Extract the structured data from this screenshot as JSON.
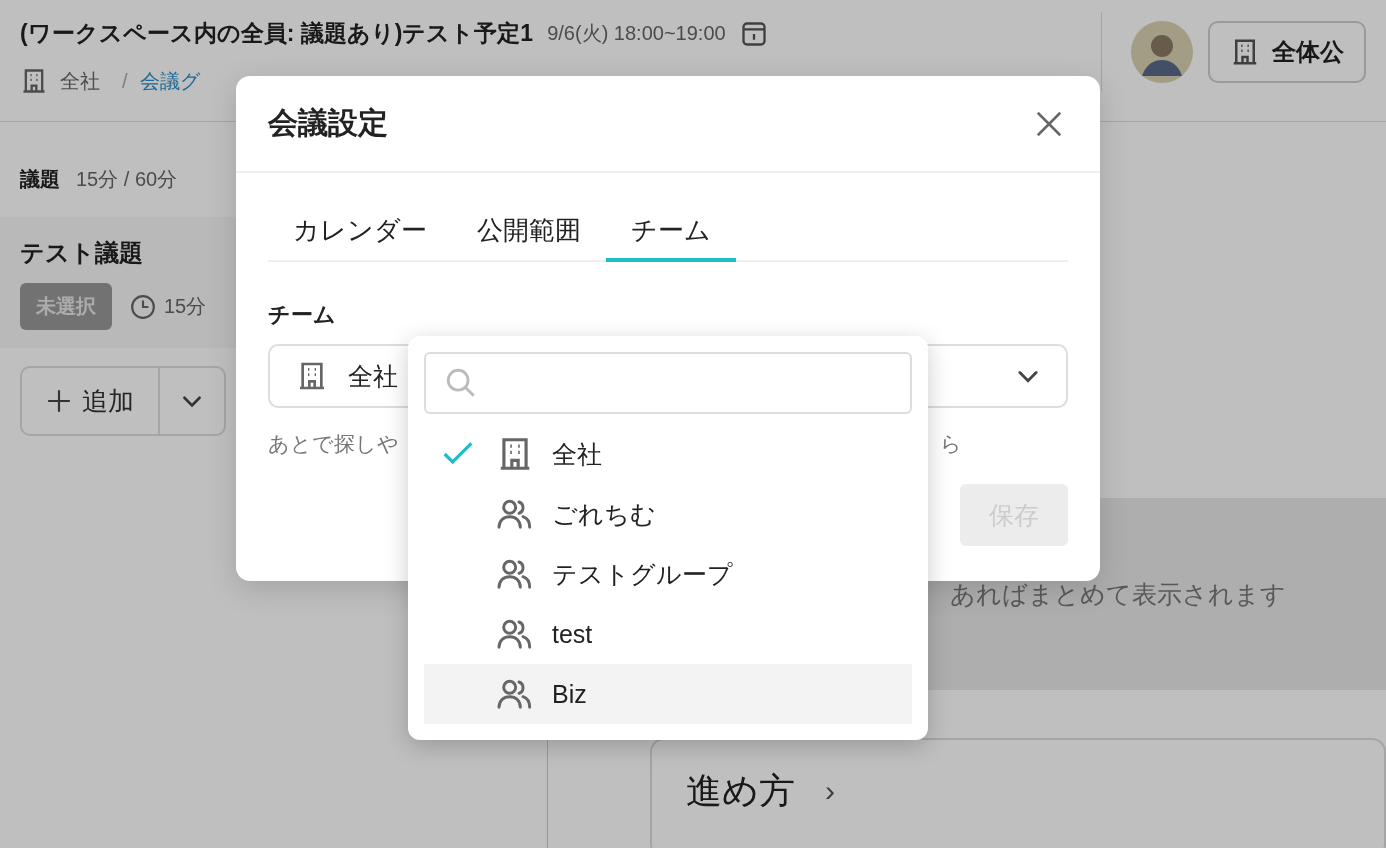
{
  "header": {
    "title": "(ワークスペース内の全員: 議題あり)テスト予定1",
    "datetime": "9/6(火) 18:00~19:00",
    "breadcrumb": {
      "team": "全社",
      "separator": "/",
      "link": "会議グ"
    },
    "visibility_button": "全体公"
  },
  "agenda": {
    "label": "議題",
    "duration": "15分 / 60分",
    "items": [
      {
        "title": "テスト議題",
        "status": "未選択",
        "time": "15分"
      }
    ],
    "add_button": "追加"
  },
  "summary": {
    "text": "あればまとめて表示されます"
  },
  "guide_card": {
    "label": "進め方",
    "chevron": "›"
  },
  "dialog": {
    "title": "会議設定",
    "tabs": [
      {
        "label": "カレンダー",
        "selected": false
      },
      {
        "label": "公開範囲",
        "selected": false
      },
      {
        "label": "チーム",
        "selected": true
      }
    ],
    "field_label": "チーム",
    "select_value": "全社",
    "help_start": "あとで探しや",
    "help_end": "ら",
    "save_button": "保存",
    "save_disabled": true,
    "dropdown": {
      "options": [
        {
          "label": "全社",
          "kind": "building",
          "selected": true,
          "highlighted": false
        },
        {
          "label": "ごれちむ",
          "kind": "group",
          "selected": false,
          "highlighted": false
        },
        {
          "label": "テストグループ",
          "kind": "group",
          "selected": false,
          "highlighted": false
        },
        {
          "label": "test",
          "kind": "group",
          "selected": false,
          "highlighted": false
        },
        {
          "label": "Biz",
          "kind": "group",
          "selected": false,
          "highlighted": true
        }
      ]
    }
  }
}
